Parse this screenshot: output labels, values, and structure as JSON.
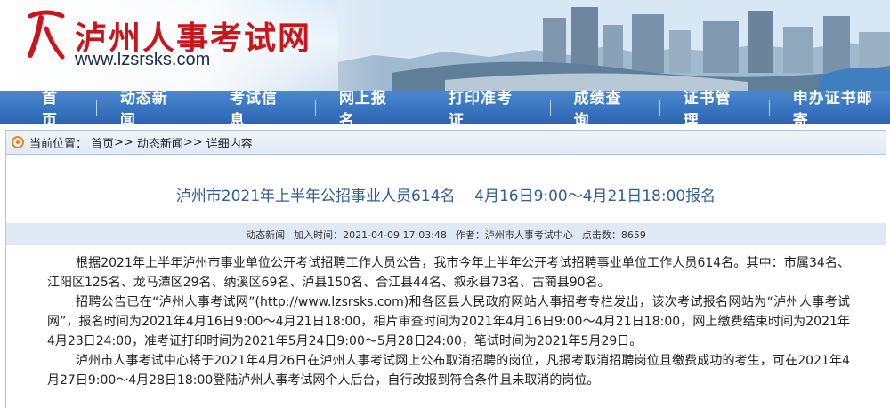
{
  "site": {
    "title": "泸州人事考试网",
    "url": "www.lzsrsks.com",
    "brand_red": "#c8161d",
    "nav_blue": "#2b64b3"
  },
  "nav": {
    "items": [
      "首页",
      "动态新闻",
      "考试信息",
      "网上报名",
      "打印准考证",
      "成绩查询",
      "证书管理",
      "申办证书邮寄"
    ]
  },
  "breadcrumb": {
    "icon": "location-pin-icon",
    "prefix": "当前位置：",
    "home": "首页",
    "sep": ">>",
    "section": "动态新闻",
    "current": "详细内容"
  },
  "article": {
    "title": "泸州市2021年上半年公招事业人员614名    4月16日9:00～4月21日18:00报名",
    "meta": {
      "category": "动态新闻",
      "added": "加入时间：2021-04-09 17:03:48",
      "author": "作者：泸州市人事考试中心",
      "views": "点击数：8659"
    },
    "paragraphs": [
      "根据2021年上半年泸州市事业单位公开考试招聘工作人员公告，我市今年上半年公开考试招聘事业单位工作人员614名。其中：市属34名、江阳区125名、龙马潭区29名、纳溪区69名、泸县150名、合江县44名、叙永县73名、古蔺县90名。",
      "招聘公告已在“泸州人事考试网”(http://www.lzsrsks.com)和各区县人民政府网站人事招考专栏发出，该次考试报名网站为“泸州人事考试网”，报名时间为2021年4月16日9:00～4月21日18:00，相片审查时间为2021年4月16日9:00～4月21日18:00，网上缴费结束时间为2021年4月23日24:00，准考证打印时间为2021年5月24日9:00～5月28日24:00，笔试时间为2021年5月29日。",
      "泸州市人事考试中心将于2021年4月26日在泸州人事考试网上公布取消招聘的岗位，凡报考取消招聘岗位且缴费成功的考生，可在2021年4月27日9:00～4月28日18:00登陆泸州人事考试网个人后台，自行改报到符合条件且未取消的岗位。"
    ]
  }
}
